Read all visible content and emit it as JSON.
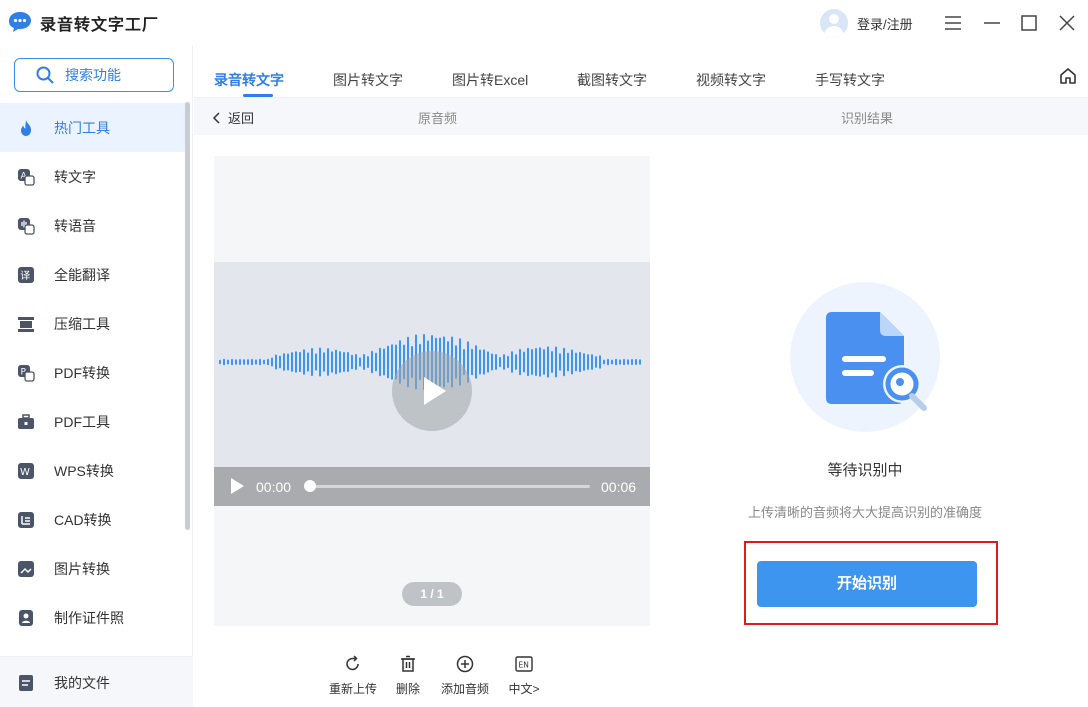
{
  "app": {
    "title": "录音转文字工厂",
    "login": "登录/注册"
  },
  "sidebar": {
    "search": "搜索功能",
    "items": [
      {
        "label": "热门工具",
        "icon": "fire-icon"
      },
      {
        "label": "转文字",
        "icon": "text-convert-icon"
      },
      {
        "label": "转语音",
        "icon": "voice-icon"
      },
      {
        "label": "全能翻译",
        "icon": "translate-icon"
      },
      {
        "label": "压缩工具",
        "icon": "compress-icon"
      },
      {
        "label": "PDF转换",
        "icon": "pdf-convert-icon"
      },
      {
        "label": "PDF工具",
        "icon": "toolbox-icon"
      },
      {
        "label": "WPS转换",
        "icon": "wps-icon"
      },
      {
        "label": "CAD转换",
        "icon": "cad-icon"
      },
      {
        "label": "图片转换",
        "icon": "image-icon"
      },
      {
        "label": "制作证件照",
        "icon": "id-photo-icon"
      }
    ],
    "my_files": "我的文件"
  },
  "tabs": [
    {
      "label": "录音转文字",
      "active": true
    },
    {
      "label": "图片转文字",
      "active": false
    },
    {
      "label": "图片转Excel",
      "active": false
    },
    {
      "label": "截图转文字",
      "active": false
    },
    {
      "label": "视频转文字",
      "active": false
    },
    {
      "label": "手写转文字",
      "active": false
    }
  ],
  "subbar": {
    "back": "返回",
    "original": "原音频",
    "result": "识别结果"
  },
  "player": {
    "current_time": "00:00",
    "duration": "00:06",
    "progress": 0,
    "page": "1 / 1"
  },
  "tools": {
    "reupload": "重新上传",
    "delete": "删除",
    "add_audio": "添加音频",
    "lang": "中文>",
    "lang_badge": "EN"
  },
  "result": {
    "status": "等待识别中",
    "hint": "上传清晰的音频将大大提高识别的准确度",
    "start_button": "开始识别"
  },
  "colors": {
    "accent": "#2f7fe6",
    "button": "#3d95ef",
    "highlight": "#e01b1b"
  }
}
